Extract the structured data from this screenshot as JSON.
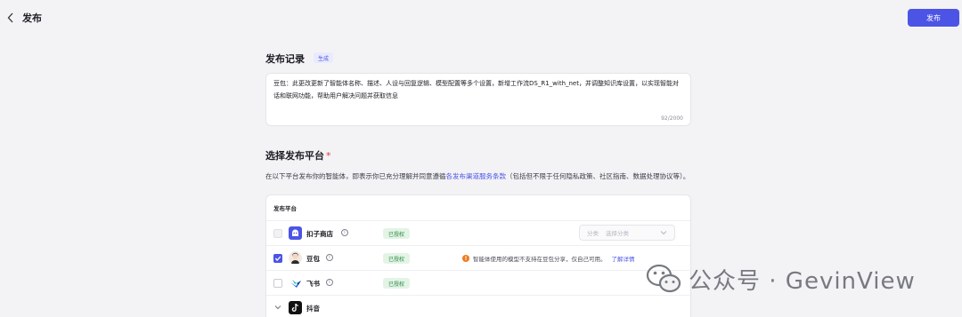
{
  "header": {
    "title": "发布",
    "publish_button": "发布"
  },
  "record": {
    "title": "发布记录",
    "generate_tag": "生成",
    "text": "豆包：此更改更新了智能体名称、描述、人设与回复逻辑、模型配置等多个设置，新增工作流DS_R1_with_net，并调整知识库设置，以实现智能对话和联网功能，帮助用户解决问题并获取信息",
    "counter": "92/2000"
  },
  "platform": {
    "title": "选择发布平台",
    "required_mark": "*",
    "desc_before": "在以下平台发布你的智能体，即表示你已充分理解并同意遵循",
    "desc_link": "各发布渠道服务条款",
    "desc_after": "（包括但不限于任何隐私政策、社区指南、数据处理协议等）。",
    "table_header": "发布平台",
    "rows": [
      {
        "name": "扣子商店",
        "auth": "已授权",
        "select_label": "分类",
        "select_placeholder": "选择分类"
      },
      {
        "name": "豆包",
        "auth": "已授权",
        "warning": "智能体使用的模型不支持在豆包分享，仅自己可用。",
        "warning_link": "了解详情"
      },
      {
        "name": "飞书",
        "auth": "已授权"
      },
      {
        "name": "抖音"
      }
    ]
  },
  "watermark": "公众号 · GevinView",
  "colors": {
    "accent": "#4c54e6",
    "auth_green": "#2d8a43",
    "warning_orange": "#ee7b1e",
    "required_red": "#e23b3b"
  },
  "icons": [
    "back-chevron-icon",
    "info-icon",
    "check-icon",
    "chevron-down-icon",
    "warning-icon",
    "wechat-icon"
  ]
}
